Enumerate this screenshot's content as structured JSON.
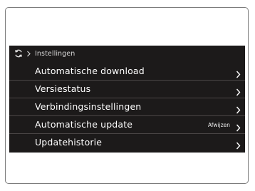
{
  "header": {
    "sync_icon": "sync-icon",
    "separator_icon": "chevron-right-icon",
    "breadcrumb": "Instellingen"
  },
  "menu": {
    "items": [
      {
        "label": "Automatische download",
        "value": "",
        "icon": "chevron-right-icon"
      },
      {
        "label": "Versiestatus",
        "value": "",
        "icon": "chevron-right-icon"
      },
      {
        "label": "Verbindingsinstellingen",
        "value": "",
        "icon": "chevron-right-icon"
      },
      {
        "label": "Automatische update",
        "value": "Afwijzen",
        "icon": "chevron-right-icon"
      },
      {
        "label": "Updatehistorie",
        "value": "",
        "icon": "chevron-right-icon"
      }
    ]
  },
  "colors": {
    "screen_background": "#1c1a1a",
    "text": "#ffffff",
    "divider": "#4a4646"
  }
}
